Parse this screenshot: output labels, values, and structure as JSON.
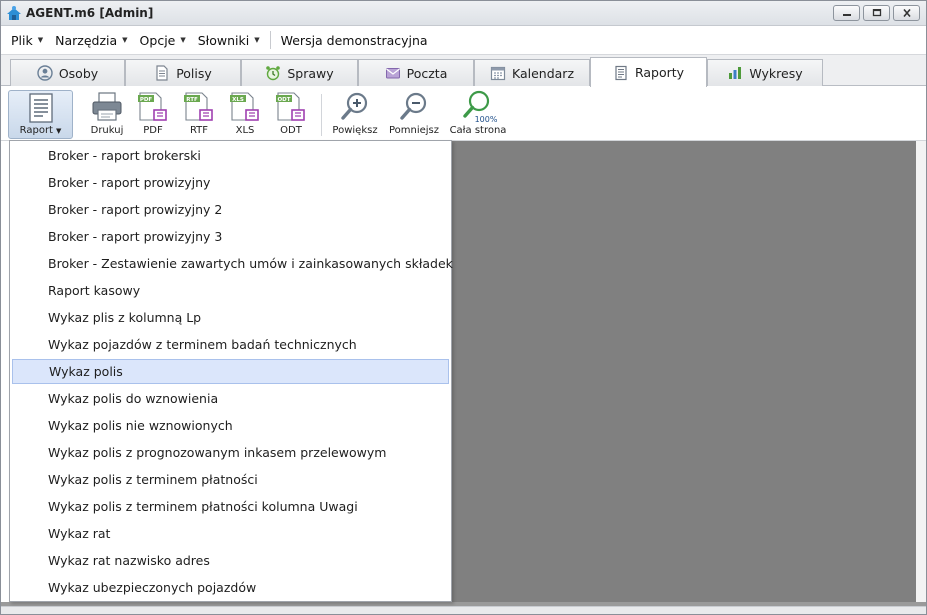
{
  "window": {
    "title": "AGENT.m6 [Admin]"
  },
  "menubar": {
    "items": [
      {
        "label": "Plik"
      },
      {
        "label": "Narzędzia"
      },
      {
        "label": "Opcje"
      },
      {
        "label": "Słowniki"
      }
    ],
    "static_text": "Wersja demonstracyjna"
  },
  "tabs": [
    {
      "label": "Osoby",
      "icon": "person-icon"
    },
    {
      "label": "Polisy",
      "icon": "document-icon"
    },
    {
      "label": "Sprawy",
      "icon": "alarm-clock-icon"
    },
    {
      "label": "Poczta",
      "icon": "mail-icon"
    },
    {
      "label": "Kalendarz",
      "icon": "calendar-icon"
    },
    {
      "label": "Raporty",
      "icon": "report-icon",
      "active": true
    },
    {
      "label": "Wykresy",
      "icon": "bar-chart-icon"
    }
  ],
  "toolbar": {
    "raport": "Raport",
    "drukuj": "Drukuj",
    "pdf": "PDF",
    "rtf": "RTF",
    "xls": "XLS",
    "odt": "ODT",
    "powieksz": "Powiększ",
    "pomniejsz": "Pomniejsz",
    "cala_strona": "Cała strona",
    "zoom_badge": "100%",
    "pdf_tag": "PDF",
    "rtf_tag": "RTF",
    "xls_tag": "XLS",
    "odt_tag": "ODT"
  },
  "report_menu": {
    "highlighted_index": 8,
    "items": [
      "Broker - raport brokerski",
      "Broker - raport prowizyjny",
      "Broker - raport prowizyjny 2",
      "Broker - raport prowizyjny 3",
      "Broker - Zestawienie zawartych umów i zainkasowanych składek",
      "Raport kasowy",
      "Wykaz plis z kolumną Lp",
      "Wykaz pojazdów z terminem badań technicznych",
      "Wykaz polis",
      "Wykaz polis do wznowienia",
      "Wykaz polis nie wznowionych",
      "Wykaz polis z prognozowanym inkasem przelewowym",
      "Wykaz polis z terminem płatności",
      "Wykaz polis z terminem płatności kolumna Uwagi",
      "Wykaz rat",
      "Wykaz rat nazwisko adres",
      "Wykaz ubezpieczonych pojazdów"
    ]
  },
  "colors": {
    "accent": "#2f6fd0",
    "canvas_gray": "#808080",
    "highlight": "#dbe6fb"
  }
}
